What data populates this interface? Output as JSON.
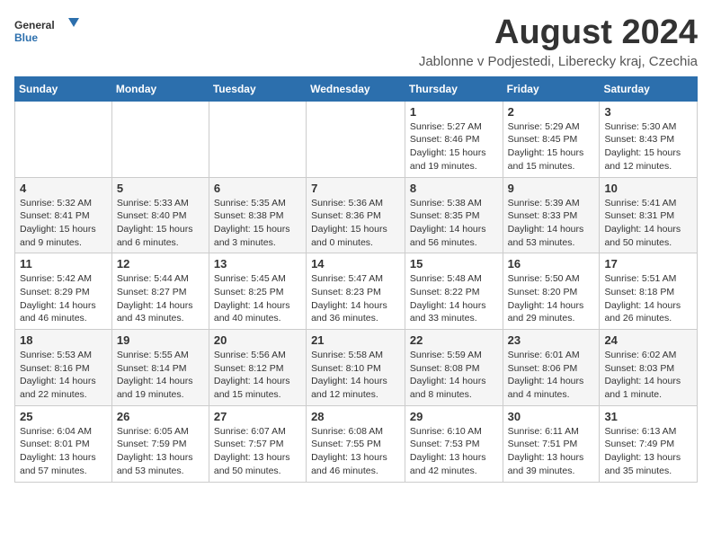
{
  "logo": {
    "line1": "General",
    "line2": "Blue"
  },
  "title": "August 2024",
  "subtitle": "Jablonne v Podjestedi, Liberecky kraj, Czechia",
  "days_of_week": [
    "Sunday",
    "Monday",
    "Tuesday",
    "Wednesday",
    "Thursday",
    "Friday",
    "Saturday"
  ],
  "weeks": [
    [
      {
        "day": "",
        "info": ""
      },
      {
        "day": "",
        "info": ""
      },
      {
        "day": "",
        "info": ""
      },
      {
        "day": "",
        "info": ""
      },
      {
        "day": "1",
        "info": "Sunrise: 5:27 AM\nSunset: 8:46 PM\nDaylight: 15 hours\nand 19 minutes."
      },
      {
        "day": "2",
        "info": "Sunrise: 5:29 AM\nSunset: 8:45 PM\nDaylight: 15 hours\nand 15 minutes."
      },
      {
        "day": "3",
        "info": "Sunrise: 5:30 AM\nSunset: 8:43 PM\nDaylight: 15 hours\nand 12 minutes."
      }
    ],
    [
      {
        "day": "4",
        "info": "Sunrise: 5:32 AM\nSunset: 8:41 PM\nDaylight: 15 hours\nand 9 minutes."
      },
      {
        "day": "5",
        "info": "Sunrise: 5:33 AM\nSunset: 8:40 PM\nDaylight: 15 hours\nand 6 minutes."
      },
      {
        "day": "6",
        "info": "Sunrise: 5:35 AM\nSunset: 8:38 PM\nDaylight: 15 hours\nand 3 minutes."
      },
      {
        "day": "7",
        "info": "Sunrise: 5:36 AM\nSunset: 8:36 PM\nDaylight: 15 hours\nand 0 minutes."
      },
      {
        "day": "8",
        "info": "Sunrise: 5:38 AM\nSunset: 8:35 PM\nDaylight: 14 hours\nand 56 minutes."
      },
      {
        "day": "9",
        "info": "Sunrise: 5:39 AM\nSunset: 8:33 PM\nDaylight: 14 hours\nand 53 minutes."
      },
      {
        "day": "10",
        "info": "Sunrise: 5:41 AM\nSunset: 8:31 PM\nDaylight: 14 hours\nand 50 minutes."
      }
    ],
    [
      {
        "day": "11",
        "info": "Sunrise: 5:42 AM\nSunset: 8:29 PM\nDaylight: 14 hours\nand 46 minutes."
      },
      {
        "day": "12",
        "info": "Sunrise: 5:44 AM\nSunset: 8:27 PM\nDaylight: 14 hours\nand 43 minutes."
      },
      {
        "day": "13",
        "info": "Sunrise: 5:45 AM\nSunset: 8:25 PM\nDaylight: 14 hours\nand 40 minutes."
      },
      {
        "day": "14",
        "info": "Sunrise: 5:47 AM\nSunset: 8:23 PM\nDaylight: 14 hours\nand 36 minutes."
      },
      {
        "day": "15",
        "info": "Sunrise: 5:48 AM\nSunset: 8:22 PM\nDaylight: 14 hours\nand 33 minutes."
      },
      {
        "day": "16",
        "info": "Sunrise: 5:50 AM\nSunset: 8:20 PM\nDaylight: 14 hours\nand 29 minutes."
      },
      {
        "day": "17",
        "info": "Sunrise: 5:51 AM\nSunset: 8:18 PM\nDaylight: 14 hours\nand 26 minutes."
      }
    ],
    [
      {
        "day": "18",
        "info": "Sunrise: 5:53 AM\nSunset: 8:16 PM\nDaylight: 14 hours\nand 22 minutes."
      },
      {
        "day": "19",
        "info": "Sunrise: 5:55 AM\nSunset: 8:14 PM\nDaylight: 14 hours\nand 19 minutes."
      },
      {
        "day": "20",
        "info": "Sunrise: 5:56 AM\nSunset: 8:12 PM\nDaylight: 14 hours\nand 15 minutes."
      },
      {
        "day": "21",
        "info": "Sunrise: 5:58 AM\nSunset: 8:10 PM\nDaylight: 14 hours\nand 12 minutes."
      },
      {
        "day": "22",
        "info": "Sunrise: 5:59 AM\nSunset: 8:08 PM\nDaylight: 14 hours\nand 8 minutes."
      },
      {
        "day": "23",
        "info": "Sunrise: 6:01 AM\nSunset: 8:06 PM\nDaylight: 14 hours\nand 4 minutes."
      },
      {
        "day": "24",
        "info": "Sunrise: 6:02 AM\nSunset: 8:03 PM\nDaylight: 14 hours\nand 1 minute."
      }
    ],
    [
      {
        "day": "25",
        "info": "Sunrise: 6:04 AM\nSunset: 8:01 PM\nDaylight: 13 hours\nand 57 minutes."
      },
      {
        "day": "26",
        "info": "Sunrise: 6:05 AM\nSunset: 7:59 PM\nDaylight: 13 hours\nand 53 minutes."
      },
      {
        "day": "27",
        "info": "Sunrise: 6:07 AM\nSunset: 7:57 PM\nDaylight: 13 hours\nand 50 minutes."
      },
      {
        "day": "28",
        "info": "Sunrise: 6:08 AM\nSunset: 7:55 PM\nDaylight: 13 hours\nand 46 minutes."
      },
      {
        "day": "29",
        "info": "Sunrise: 6:10 AM\nSunset: 7:53 PM\nDaylight: 13 hours\nand 42 minutes."
      },
      {
        "day": "30",
        "info": "Sunrise: 6:11 AM\nSunset: 7:51 PM\nDaylight: 13 hours\nand 39 minutes."
      },
      {
        "day": "31",
        "info": "Sunrise: 6:13 AM\nSunset: 7:49 PM\nDaylight: 13 hours\nand 35 minutes."
      }
    ]
  ]
}
